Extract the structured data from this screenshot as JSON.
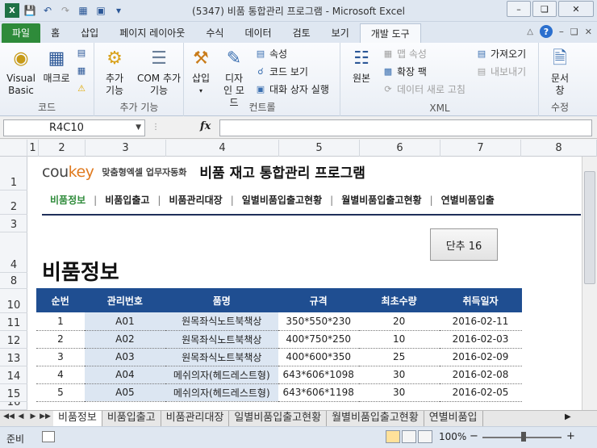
{
  "window": {
    "title": "(5347) 비품 통합관리 프로그램  -  Microsoft Excel"
  },
  "ribbon_tabs": [
    "파일",
    "홈",
    "삽입",
    "페이지 레이아웃",
    "수식",
    "데이터",
    "검토",
    "보기",
    "개발 도구"
  ],
  "active_tab": "개발 도구",
  "ribbon": {
    "code": {
      "label": "코드",
      "visual_basic": "Visual Basic",
      "macro": "매크로"
    },
    "addins": {
      "label": "추가 기능",
      "addins": "추가 기능",
      "com_addins": "COM 추가 기능"
    },
    "controls": {
      "label": "컨트롤",
      "insert": "삽입",
      "design_mode": "디자인 모드",
      "properties": "속성",
      "view_code": "코드 보기",
      "run_dialog": "대화 상자 실행"
    },
    "xml": {
      "label": "XML",
      "source": "원본",
      "map_properties": "맵 속성",
      "expansion_packs": "확장 팩",
      "refresh_data": "데이터 새로 고침",
      "import": "가져오기",
      "export": "내보내기"
    },
    "modify": {
      "label": "수정",
      "document_panel": "문서 창"
    }
  },
  "formula_bar": {
    "name_box": "R4C10",
    "fx": "fx",
    "value": ""
  },
  "columns": [
    "1",
    "2",
    "3",
    "4",
    "5",
    "6",
    "7",
    "8"
  ],
  "rows": [
    "1",
    "2",
    "3",
    "4",
    "8",
    "10",
    "11",
    "12",
    "13",
    "14",
    "15",
    "16"
  ],
  "banner": {
    "logo_main": "cou",
    "logo_accent": "key",
    "logo_sub": "맞춤형엑셀 업무자동화",
    "program_title": "비품 재고 통합관리 프로그램"
  },
  "nav": [
    "비품정보",
    "비품입출고",
    "비품관리대장",
    "일별비품입출고현황",
    "월별비품입출고현황",
    "연별비품입출"
  ],
  "page_title": "비품정보",
  "unit_button": "단추 16",
  "table": {
    "headers": [
      "순번",
      "관리번호",
      "품명",
      "규격",
      "최초수량",
      "취득일자"
    ],
    "rows": [
      [
        "1",
        "A01",
        "원목좌식노트북책상",
        "350*550*230",
        "20",
        "2016-02-11"
      ],
      [
        "2",
        "A02",
        "원목좌식노트북책상",
        "400*750*250",
        "10",
        "2016-02-03"
      ],
      [
        "3",
        "A03",
        "원목좌식노트북책상",
        "400*600*350",
        "25",
        "2016-02-09"
      ],
      [
        "4",
        "A04",
        "메쉬의자(헤드레스트형)",
        "643*606*1098",
        "30",
        "2016-02-08"
      ],
      [
        "5",
        "A05",
        "메쉬의자(헤드레스트형)",
        "643*606*1198",
        "30",
        "2016-02-05"
      ]
    ]
  },
  "sheet_tabs": [
    "비품정보",
    "비품입출고",
    "비품관리대장",
    "일별비품입출고현황",
    "월별비품입출고현황",
    "연별비품입"
  ],
  "active_sheet": "비품정보",
  "status": {
    "ready": "준비",
    "zoom": "100%",
    "zoom_minus": "−",
    "zoom_plus": "+"
  }
}
